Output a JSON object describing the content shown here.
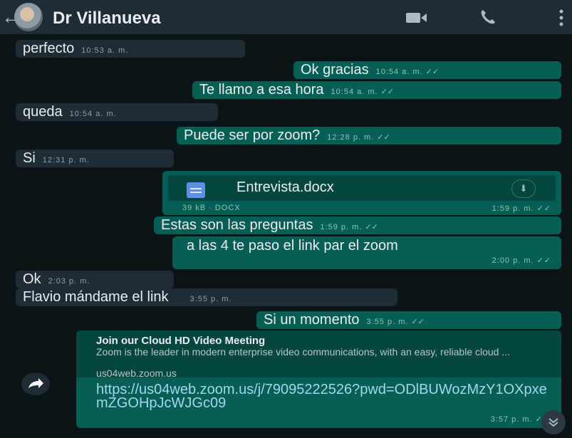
{
  "header": {
    "back_glyph": "←",
    "contact_name": "Dr Villanueva",
    "icons": [
      "back-arrow-icon",
      "avatar",
      "video-call-icon",
      "phone-icon",
      "menu-dots-icon"
    ]
  },
  "colors": {
    "background": "#0d1418",
    "header": "#1f2c34",
    "incoming": "#1f2c34",
    "outgoing": "#075e54",
    "link": "#9fd8ee"
  },
  "messages": [
    {
      "text": "perfecto",
      "time": "10:53 a. m."
    },
    {
      "text": "Ok gracias",
      "time": "10:54 a. m."
    },
    {
      "text": "Te llamo a esa hora",
      "time": "10:54 a. m."
    },
    {
      "text": "queda",
      "time": "10:54 a. m."
    },
    {
      "text": "Puede ser por zoom?",
      "time": "12:28 p. m."
    },
    {
      "text": "Si",
      "time": "12:31 p. m."
    },
    {
      "text": "Estas son las preguntas",
      "time": "1:59 p. m."
    },
    {
      "text": "a las 4 te paso el link par el zoom",
      "time": "2:00 p. m."
    },
    {
      "text": "Ok",
      "time": "2:03 p. m."
    },
    {
      "text": "Flavio mándame el link",
      "time": "3:55 p. m."
    },
    {
      "text": "Si un momento",
      "time": "3:55 p. m."
    }
  ],
  "document": {
    "name": "Entrevista.docx",
    "meta": "39 kB · DOCX",
    "time": "1:59 p. m.",
    "download_glyph": "⬇"
  },
  "link_message": {
    "preview_title": "Join our Cloud HD Video Meeting",
    "preview_desc": "Zoom is the leader in modern enterprise video communications, with an easy, reliable cloud ...",
    "preview_domain": "us04web.zoom.us",
    "url": "https://us04web.zoom.us/j/79095222526?pwd=ODlBUWozMzY1OXpxemZGOHpJcWJGc09",
    "time": "3:57 p. m."
  },
  "check_glyph": "✓✓"
}
